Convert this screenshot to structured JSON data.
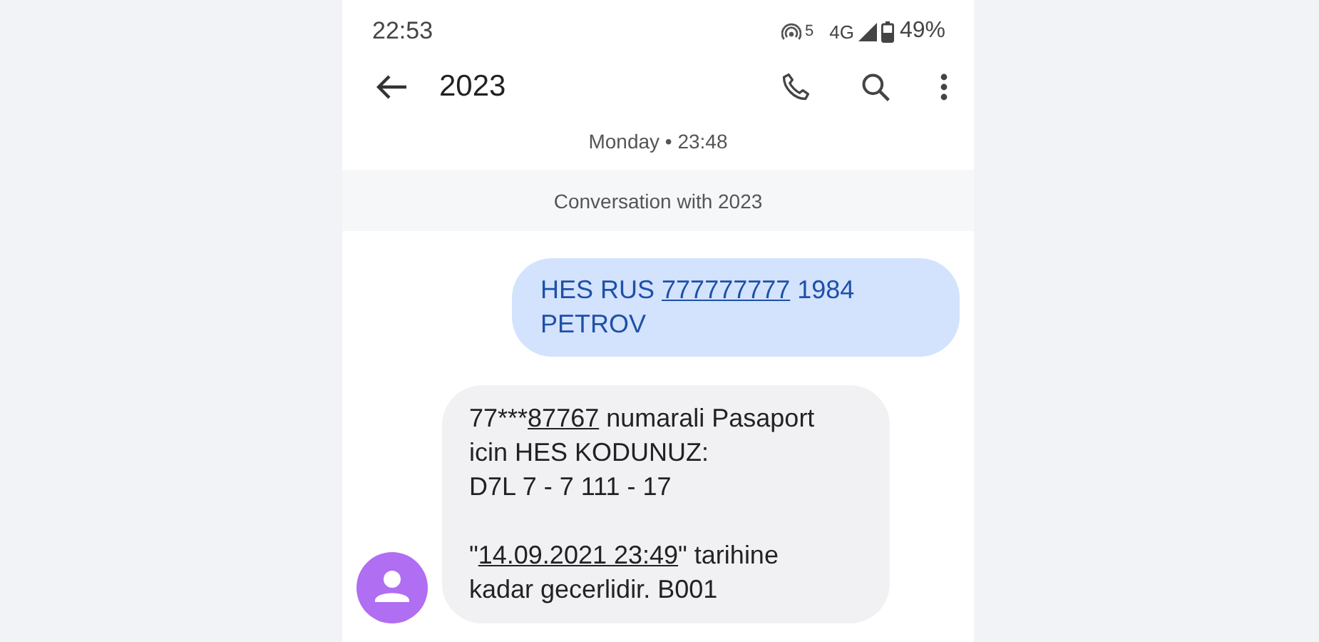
{
  "status_bar": {
    "time": "22:53",
    "hotspot_label": "5",
    "network": "4G",
    "battery": "49%"
  },
  "header": {
    "title": "2023"
  },
  "date_label": "Monday • 23:48",
  "conversation_banner": "Conversation with 2023",
  "messages": [
    {
      "kind": "sent",
      "paragraphs": [
        [
          [
            {
              "kind": "text",
              "text": "HES RUS "
            },
            {
              "kind": "link",
              "text": "777777777"
            },
            {
              "kind": "text",
              "text": " 1984"
            }
          ],
          [
            {
              "kind": "text",
              "text": "PETROV"
            }
          ]
        ]
      ]
    },
    {
      "kind": "received",
      "paragraphs": [
        [
          [
            {
              "kind": "text",
              "text": "77***"
            },
            {
              "kind": "link",
              "text": "87767"
            },
            {
              "kind": "text",
              "text": " numarali Pasaport"
            }
          ],
          [
            {
              "kind": "text",
              "text": "icin HES KODUNUZ:"
            }
          ],
          [
            {
              "kind": "text",
              "text": "D7L 7 - 7 111 - 17"
            }
          ]
        ],
        [
          [
            {
              "kind": "text",
              "text": "\""
            },
            {
              "kind": "link",
              "text": "14.09.2021 23:49"
            },
            {
              "kind": "text",
              "text": "\" tarihine"
            }
          ],
          [
            {
              "kind": "text",
              "text": "kadar gecerlidir. B001"
            }
          ]
        ]
      ]
    }
  ]
}
